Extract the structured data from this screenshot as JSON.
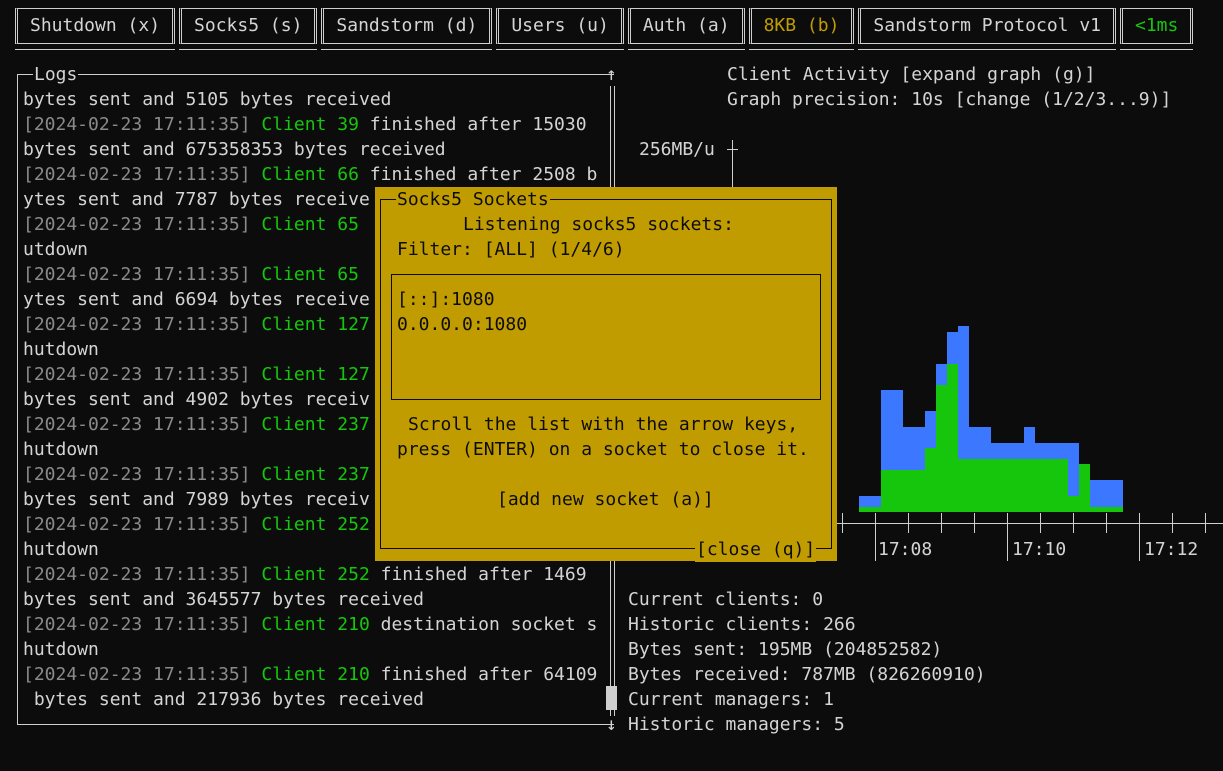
{
  "tabs": [
    {
      "label": "Shutdown (x)",
      "color": "#d4d4d4"
    },
    {
      "label": "Socks5 (s)",
      "color": "#d4d4d4"
    },
    {
      "label": "Sandstorm (d)",
      "color": "#d4d4d4"
    },
    {
      "label": "Users (u)",
      "color": "#d4d4d4"
    },
    {
      "label": "Auth (a)",
      "color": "#d4d4d4"
    },
    {
      "label": "8KB (b)",
      "color": "#c19c00"
    },
    {
      "label": "Sandstorm Protocol v1",
      "color": "#d4d4d4"
    },
    {
      "label": "<1ms",
      "color": "#16c60c"
    }
  ],
  "logs": {
    "title": "Logs",
    "scroll_up": "↑",
    "scroll_down": "↓",
    "lines": [
      [
        {
          "t": "bytes sent and 5105 bytes received",
          "c": ""
        }
      ],
      [
        {
          "t": "[2024-02-23 17:11:35] ",
          "c": "ts"
        },
        {
          "t": "Client 39",
          "c": "cl"
        },
        {
          "t": " finished after 15030",
          "c": ""
        }
      ],
      [
        {
          "t": "bytes sent and 675358353 bytes received",
          "c": ""
        }
      ],
      [
        {
          "t": "[2024-02-23 17:11:35] ",
          "c": "ts"
        },
        {
          "t": "Client 66",
          "c": "cl"
        },
        {
          "t": " finished after 2508 b",
          "c": ""
        }
      ],
      [
        {
          "t": "ytes sent and 7787 bytes receive",
          "c": ""
        }
      ],
      [
        {
          "t": "[2024-02-23 17:11:35] ",
          "c": "ts"
        },
        {
          "t": "Client 65",
          "c": "cl"
        }
      ],
      [
        {
          "t": "utdown",
          "c": ""
        }
      ],
      [
        {
          "t": "[2024-02-23 17:11:35] ",
          "c": "ts"
        },
        {
          "t": "Client 65",
          "c": "cl"
        }
      ],
      [
        {
          "t": "ytes sent and 6694 bytes receive",
          "c": ""
        }
      ],
      [
        {
          "t": "[2024-02-23 17:11:35] ",
          "c": "ts"
        },
        {
          "t": "Client 127",
          "c": "cl"
        }
      ],
      [
        {
          "t": "hutdown",
          "c": ""
        }
      ],
      [
        {
          "t": "[2024-02-23 17:11:35] ",
          "c": "ts"
        },
        {
          "t": "Client 127",
          "c": "cl"
        }
      ],
      [
        {
          "t": "bytes sent and 4902 bytes receiv",
          "c": ""
        }
      ],
      [
        {
          "t": "[2024-02-23 17:11:35] ",
          "c": "ts"
        },
        {
          "t": "Client 237",
          "c": "cl"
        }
      ],
      [
        {
          "t": "hutdown",
          "c": ""
        }
      ],
      [
        {
          "t": "[2024-02-23 17:11:35] ",
          "c": "ts"
        },
        {
          "t": "Client 237",
          "c": "cl"
        }
      ],
      [
        {
          "t": "bytes sent and 7989 bytes receiv",
          "c": ""
        }
      ],
      [
        {
          "t": "[2024-02-23 17:11:35] ",
          "c": "ts"
        },
        {
          "t": "Client 252",
          "c": "cl"
        }
      ],
      [
        {
          "t": "hutdown",
          "c": ""
        }
      ],
      [
        {
          "t": "[2024-02-23 17:11:35] ",
          "c": "ts"
        },
        {
          "t": "Client 252",
          "c": "cl"
        },
        {
          "t": " finished after 1469",
          "c": ""
        }
      ],
      [
        {
          "t": "bytes sent and 3645577 bytes received",
          "c": ""
        }
      ],
      [
        {
          "t": "[2024-02-23 17:11:35] ",
          "c": "ts"
        },
        {
          "t": "Client 210",
          "c": "cl"
        },
        {
          "t": " destination socket s",
          "c": ""
        }
      ],
      [
        {
          "t": "hutdown",
          "c": ""
        }
      ],
      [
        {
          "t": "[2024-02-23 17:11:35] ",
          "c": "ts"
        },
        {
          "t": "Client 210",
          "c": "cl"
        },
        {
          "t": " finished after 64109",
          "c": ""
        }
      ],
      [
        {
          "t": " bytes sent and 217936 bytes received",
          "c": ""
        }
      ]
    ]
  },
  "graph": {
    "title": "Client Activity [expand graph (g)]",
    "precision": "Graph precision: 10s [change (1/2/3...9)]",
    "y_label": "256MB/u",
    "colors": {
      "sent": "#3b78ff",
      "received": "#16c60c"
    }
  },
  "chart_data": {
    "type": "bar",
    "x_tick_labels": [
      "17:08",
      "17:10",
      "17:12"
    ],
    "series": [
      {
        "values": [
          0.3,
          0.3,
          2.3,
          2.3,
          1.6,
          1.6,
          1.9,
          2.8,
          3.4,
          3.5,
          1.6,
          1.6,
          1.3,
          1.3,
          1.3,
          1.6,
          1.3,
          1.3,
          1.3,
          1.3,
          0.6,
          0.6,
          0.6,
          0.6
        ]
      },
      {
        "values": [
          0.1,
          0.1,
          0.8,
          0.8,
          0.8,
          0.8,
          1.2,
          2.4,
          2.8,
          1.0,
          1.0,
          1.0,
          1.0,
          1.0,
          1.0,
          1.0,
          1.0,
          1.0,
          1.0,
          0.3,
          0.9,
          0.1,
          0.1,
          0.1
        ]
      }
    ]
  },
  "stats": [
    "Current clients: 0",
    "Historic clients: 266",
    "Bytes sent: 195MB (204852582)",
    "Bytes received: 787MB (826260910)",
    "Current managers: 1",
    "Historic managers: 5"
  ],
  "dialog": {
    "title": "Socks5 Sockets",
    "heading": "Listening socks5 sockets:",
    "filter": "Filter: [ALL] (1/4/6)",
    "sockets": [
      "[::]:1080",
      "0.0.0.0:1080"
    ],
    "help1": "Scroll the list with the arrow keys,",
    "help2": "press (ENTER) on a socket to close it.",
    "add": "[add new socket (a)]",
    "close": "[close (q)]",
    "bg": "#c19c00"
  }
}
